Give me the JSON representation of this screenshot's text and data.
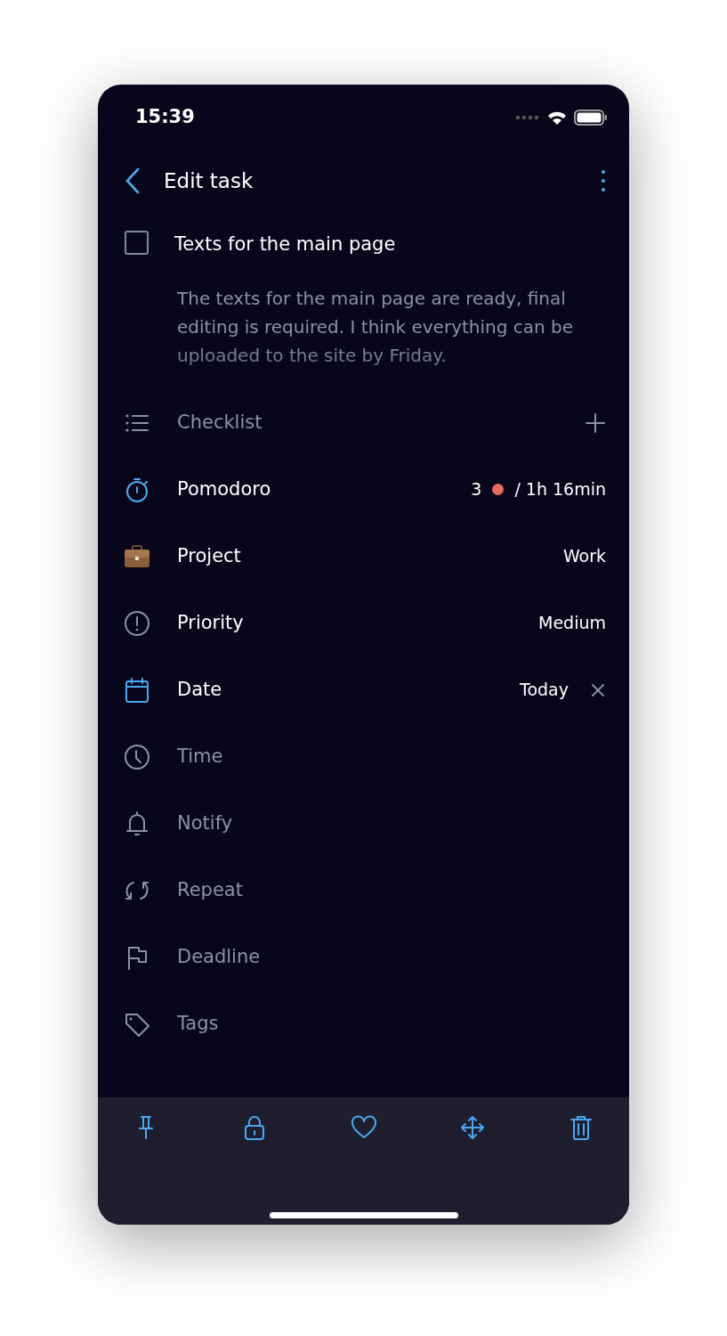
{
  "status_bar": {
    "time": "15:39"
  },
  "header": {
    "title": "Edit task"
  },
  "task": {
    "title": "Texts for the main page",
    "checked": false,
    "description": "The texts for the main page are ready, final editing is required. I think everything can be uploaded to the site by Friday."
  },
  "fields": [
    {
      "kind": "checklist",
      "label": "Checklist",
      "set": false,
      "accent": false
    },
    {
      "kind": "timer",
      "label": "Pomodoro",
      "set": true,
      "accent": true,
      "count": "3",
      "color": "#e8695e",
      "value": "/ 1h 16min"
    },
    {
      "kind": "briefcase",
      "label": "Project",
      "set": true,
      "accent": false,
      "value": "Work"
    },
    {
      "kind": "alert",
      "label": "Priority",
      "set": true,
      "accent": false,
      "value": "Medium"
    },
    {
      "kind": "calendar",
      "label": "Date",
      "set": true,
      "accent": true,
      "value": "Today"
    },
    {
      "kind": "clock",
      "label": "Time",
      "set": false,
      "accent": false
    },
    {
      "kind": "bell",
      "label": "Notify",
      "set": false,
      "accent": false
    },
    {
      "kind": "repeat",
      "label": "Repeat",
      "set": false,
      "accent": false
    },
    {
      "kind": "flag",
      "label": "Deadline",
      "set": false,
      "accent": false
    },
    {
      "kind": "tag",
      "label": "Tags",
      "set": false,
      "accent": false
    }
  ],
  "toolbar": [
    {
      "kind": "pin"
    },
    {
      "kind": "lock"
    },
    {
      "kind": "heart"
    },
    {
      "kind": "move"
    },
    {
      "kind": "trash"
    }
  ]
}
